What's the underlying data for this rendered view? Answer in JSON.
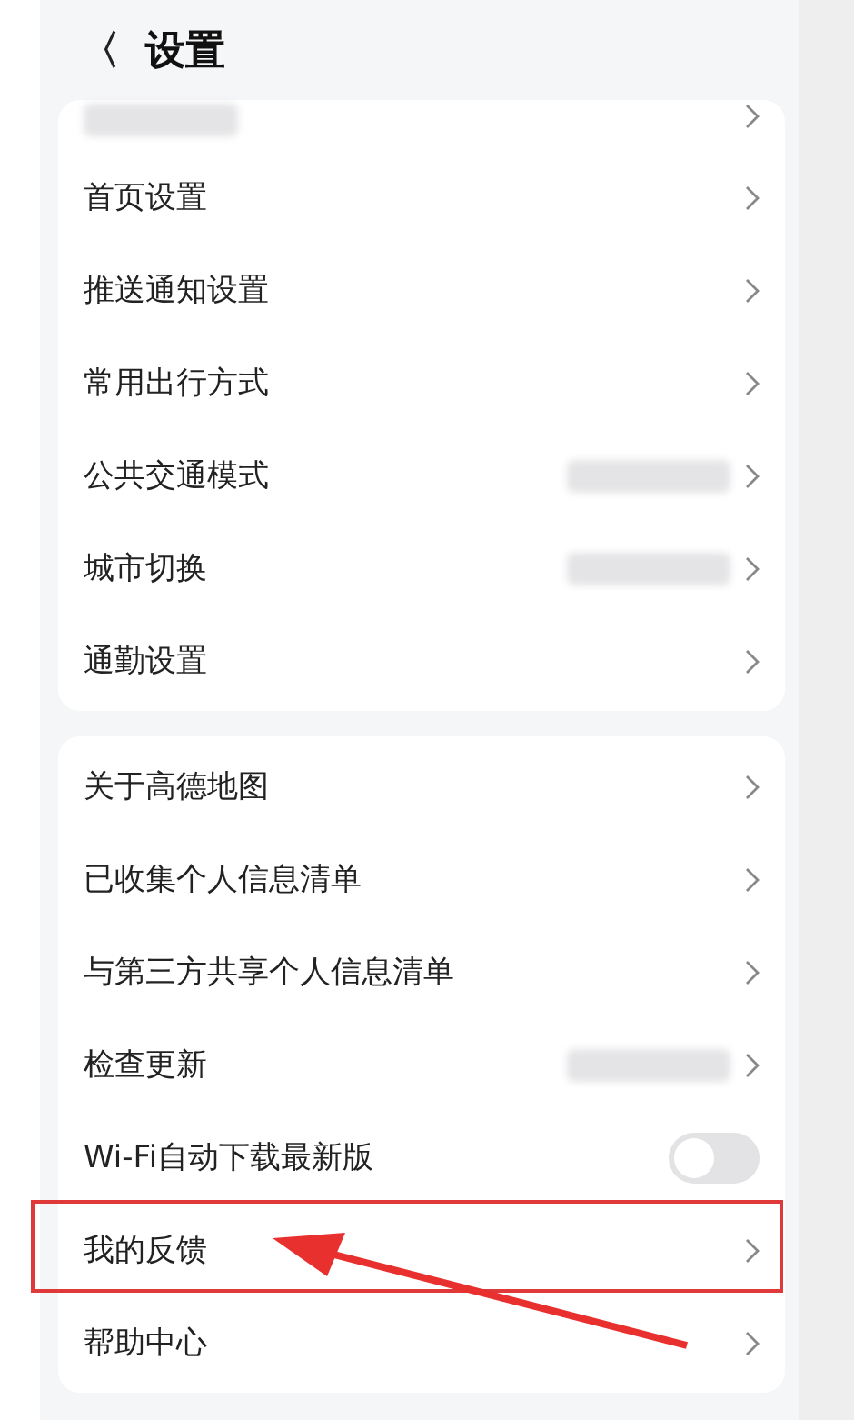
{
  "header": {
    "back": "〈",
    "title": "设置"
  },
  "groups": [
    {
      "rows": [
        {
          "kind": "link",
          "blurred_label": true,
          "blurred_value": false
        },
        {
          "kind": "link",
          "label": "首页设置",
          "blurred_label": false,
          "blurred_value": false
        },
        {
          "kind": "link",
          "label": "推送通知设置",
          "blurred_label": false,
          "blurred_value": false
        },
        {
          "kind": "link",
          "label": "常用出行方式",
          "blurred_label": false,
          "blurred_value": false
        },
        {
          "kind": "link",
          "label": "公共交通模式",
          "blurred_label": false,
          "blurred_value": true
        },
        {
          "kind": "link",
          "label": "城市切换",
          "blurred_label": false,
          "blurred_value": true
        },
        {
          "kind": "link",
          "label": "通勤设置",
          "blurred_label": false,
          "blurred_value": false
        }
      ]
    },
    {
      "rows": [
        {
          "kind": "link",
          "label": "关于高德地图",
          "blurred_label": false,
          "blurred_value": false
        },
        {
          "kind": "link",
          "label": "已收集个人信息清单",
          "blurred_label": false,
          "blurred_value": false
        },
        {
          "kind": "link",
          "label": "与第三方共享个人信息清单",
          "blurred_label": false,
          "blurred_value": false
        },
        {
          "kind": "link",
          "label": "检查更新",
          "blurred_label": false,
          "blurred_value": true
        },
        {
          "kind": "toggle",
          "label": "Wi-Fi自动下载最新版",
          "on": false
        },
        {
          "kind": "link",
          "label": "我的反馈",
          "blurred_label": false,
          "blurred_value": false,
          "highlighted": true
        },
        {
          "kind": "link",
          "label": "帮助中心",
          "blurred_label": false,
          "blurred_value": false
        }
      ]
    }
  ]
}
